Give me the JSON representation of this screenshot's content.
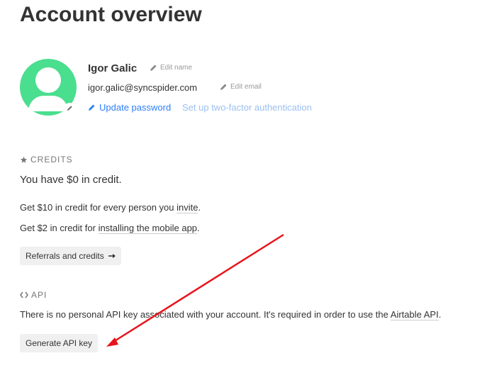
{
  "page": {
    "title": "Account overview"
  },
  "profile": {
    "name": "Igor Galic",
    "edit_name_label": "Edit name",
    "email": "igor.galic@syncspider.com",
    "edit_email_label": "Edit email",
    "update_password_label": "Update password",
    "two_factor_label": "Set up two-factor authentication"
  },
  "credits": {
    "section_label": "CREDITS",
    "balance_text": "You have $0 in credit.",
    "invite_prefix": "Get $10 in credit for every person you ",
    "invite_link": "invite",
    "invite_suffix": ".",
    "mobile_prefix": "Get $2 in credit for ",
    "mobile_link": "installing the mobile app",
    "mobile_suffix": ".",
    "referrals_button_label": "Referrals and credits"
  },
  "api": {
    "section_label": "API",
    "description_prefix": "There is no personal API key associated with your account. It's required in order to use the ",
    "description_link": "Airtable API",
    "description_suffix": ".",
    "generate_button_label": "Generate API key"
  },
  "colors": {
    "accent_blue": "#2d7ff9",
    "avatar_green": "#4ade8f",
    "annotation_arrow": "#e8141b"
  },
  "icons": {
    "edit": "pencil-icon",
    "credits": "star-icon",
    "api": "code-brackets-icon",
    "button_arrow": "arrow-right-icon"
  }
}
